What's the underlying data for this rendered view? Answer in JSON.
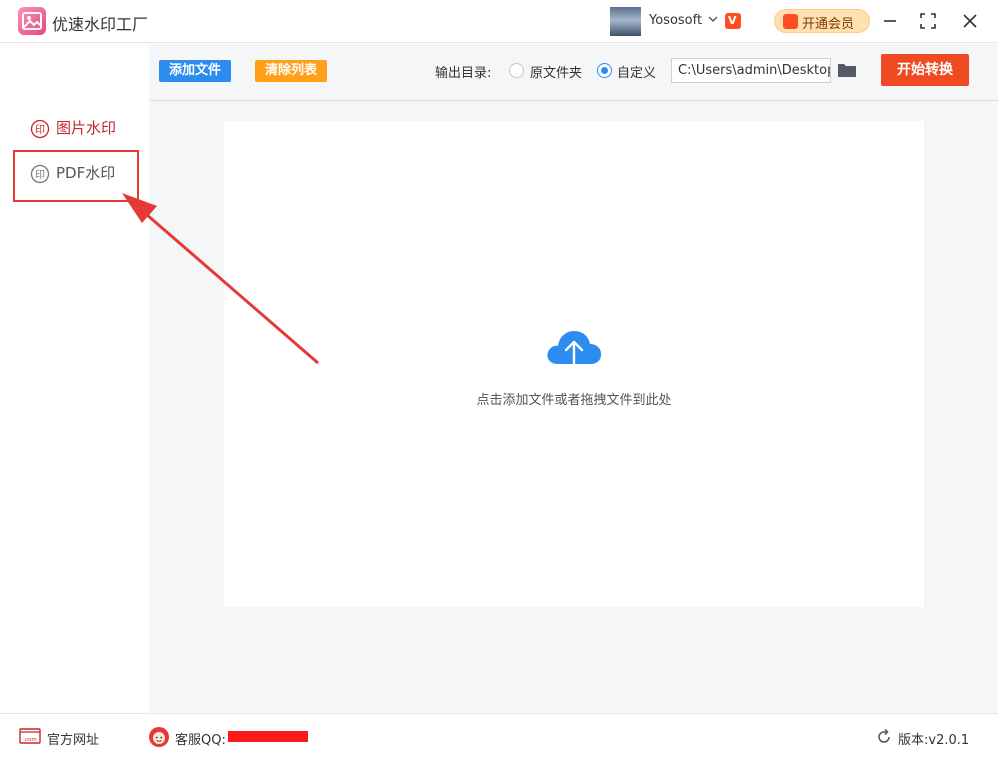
{
  "app": {
    "title": "优速水印工厂"
  },
  "user": {
    "name": "Yososoft",
    "vip_mark": "V"
  },
  "header": {
    "vip_button": "开通会员"
  },
  "sidebar": {
    "items": [
      {
        "label": "图片水印",
        "state": "active"
      },
      {
        "label": "PDF水印",
        "state": "inactive"
      }
    ]
  },
  "toolbar": {
    "add_label": "添加文件",
    "clear_label": "清除列表",
    "output_label": "输出目录:",
    "radio_original": "原文件夹",
    "radio_custom": "自定义",
    "selected_option": "自定义",
    "path_value": "C:\\Users\\admin\\Desktop",
    "start_label": "开始转换"
  },
  "dropzone": {
    "hint": "点击添加文件或者拖拽文件到此处"
  },
  "footer": {
    "website_label": "官方网址",
    "website_icon_text": ".com",
    "support_label": "客服QQ:",
    "version_label": "版本:v2.0.1"
  },
  "colors": {
    "accent_blue": "#2d8cf0",
    "clear_orange": "#ff9f1a",
    "start_red": "#f04a23",
    "annotation_red": "#e53935"
  },
  "icons": {
    "logo": "picture-logo-icon",
    "folder": "folder-icon",
    "upload": "cloud-upload-icon",
    "refresh": "refresh-icon"
  }
}
